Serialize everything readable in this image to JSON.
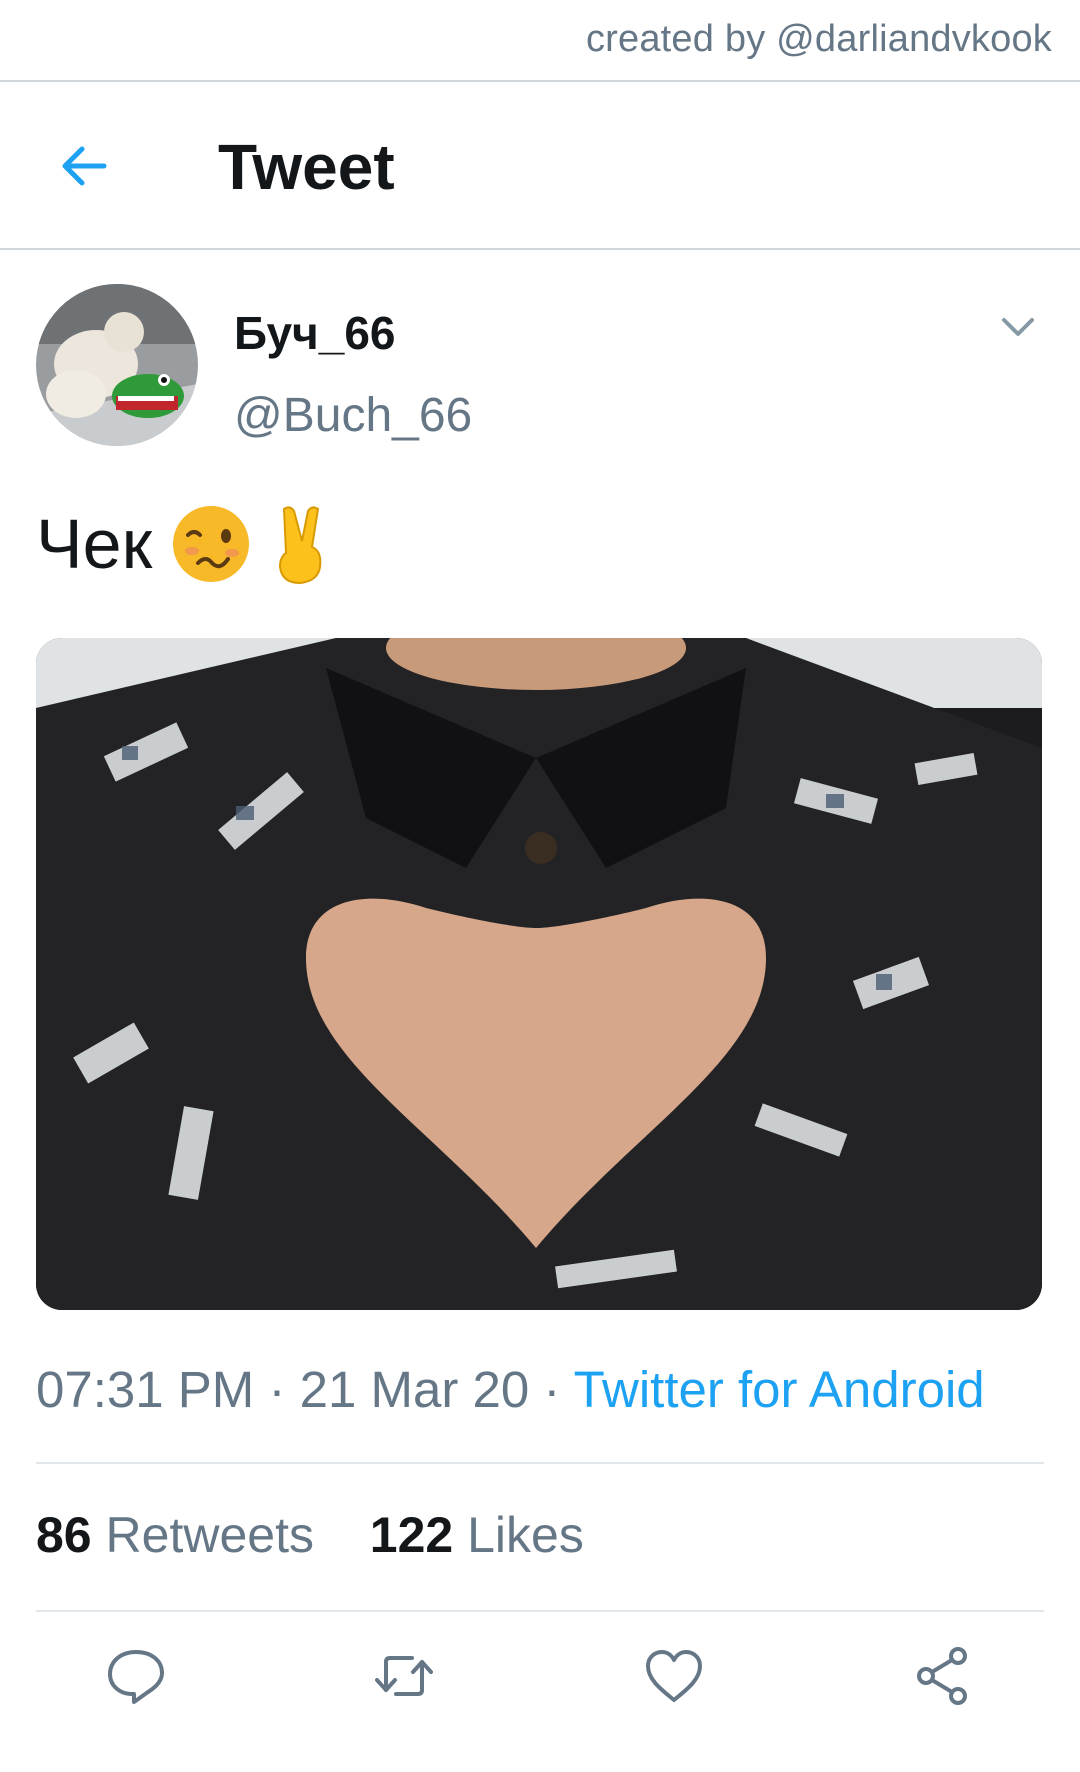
{
  "credit": "created by @darliandvkook",
  "header": {
    "title": "Tweet"
  },
  "tweet": {
    "display_name": "Буч_66",
    "handle": "@Buch_66",
    "text": "Чек",
    "emojis": [
      "woozy-face",
      "victory-hand"
    ],
    "time": "07:31 PM",
    "date": "21 Mar 20",
    "separator": "·",
    "source": "Twitter for Android",
    "retweets_count": "86",
    "retweets_label": "Retweets",
    "likes_count": "122",
    "likes_label": "Likes"
  },
  "icons": {
    "back": "arrow-left-icon",
    "more": "chevron-down-icon",
    "reply": "reply-icon",
    "retweet": "retweet-icon",
    "like": "heart-icon",
    "share": "share-icon"
  },
  "colors": {
    "accent": "#1da1f2",
    "secondary_text": "#657786",
    "primary_text": "#14171a",
    "divider": "#e1e8ed"
  }
}
